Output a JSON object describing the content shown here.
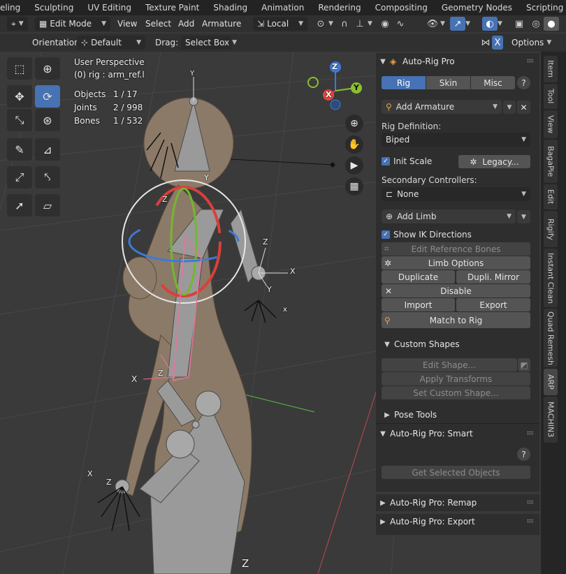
{
  "workspaces": [
    "eling",
    "Sculpting",
    "UV Editing",
    "Texture Paint",
    "Shading",
    "Animation",
    "Rendering",
    "Compositing",
    "Geometry Nodes",
    "Scripting"
  ],
  "header": {
    "mode": "Edit Mode",
    "menus": [
      "View",
      "Select",
      "Add",
      "Armature"
    ],
    "transform_space": "Local",
    "orientation_label": "Orientation:",
    "orientation_value": "Default",
    "drag_label": "Drag:",
    "drag_value": "Select Box",
    "mirror_x": "X",
    "options": "Options"
  },
  "viewport": {
    "perspective": "User Perspective",
    "object": "(0) rig : arm_ref.l",
    "stats": [
      {
        "label": "Objects",
        "value": "1 / 17"
      },
      {
        "label": "Joints",
        "value": "2 / 998"
      },
      {
        "label": "Bones",
        "value": "1 / 532"
      }
    ],
    "gizmo": {
      "z": "Z",
      "y": "Y",
      "x": "X"
    },
    "axis_labels": {
      "y_top": "Y",
      "z_mid": "Z",
      "y_mid": "Y",
      "z_right": "Z",
      "x_right": "X",
      "y_right": "Y",
      "x_hand": "x",
      "x_left": "X",
      "z_left": "Z",
      "x_bottom": "X",
      "z_bottom": "Z",
      "z_floor": "Z"
    }
  },
  "arp": {
    "title": "Auto-Rig Pro",
    "tabs": [
      "Rig",
      "Skin",
      "Misc"
    ],
    "help": "?",
    "add_armature": "Add Armature",
    "rig_definition_label": "Rig Definition:",
    "rig_definition": "Biped",
    "init_scale": "Init Scale",
    "legacy": "Legacy...",
    "secondary_label": "Secondary Controllers:",
    "secondary_value": "None",
    "add_limb": "Add Limb",
    "show_ik": "Show IK Directions",
    "edit_ref": "Edit Reference Bones",
    "limb_options": "Limb Options",
    "duplicate": "Duplicate",
    "dupli_mirror": "Dupli. Mirror",
    "disable": "Disable",
    "import": "Import",
    "export": "Export",
    "match_to_rig": "Match to Rig",
    "custom_shapes": "Custom Shapes",
    "edit_shape": "Edit Shape...",
    "apply_transforms": "Apply Transforms",
    "set_custom_shape": "Set Custom Shape...",
    "pose_tools": "Pose Tools"
  },
  "smart": {
    "title": "Auto-Rig Pro: Smart",
    "help": "?",
    "get_selected": "Get Selected Objects"
  },
  "remap": {
    "title": "Auto-Rig Pro: Remap"
  },
  "export_panel": {
    "title": "Auto-Rig Pro: Export"
  },
  "vtabs": [
    "Item",
    "Tool",
    "View",
    "BagaPie",
    "Edit",
    "Rigify",
    "Instant Clean",
    "Quad Remesh",
    "ARP",
    "MACHIN3"
  ],
  "colors": {
    "accent": "#4772b3",
    "x_axis": "#e0453e",
    "y_axis": "#8bbf2e",
    "z_axis": "#3d7bd6"
  }
}
